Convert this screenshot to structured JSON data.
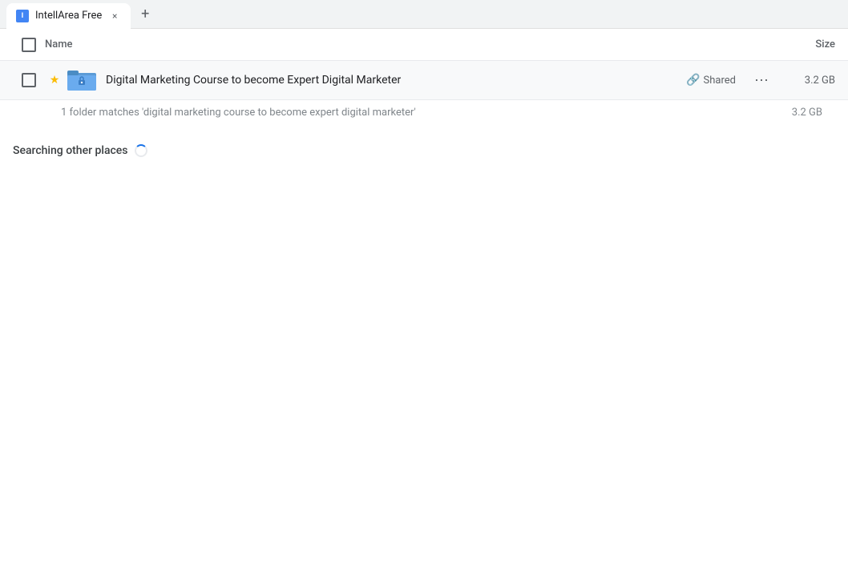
{
  "tab": {
    "favicon_label": "I",
    "title": "IntellArea Free",
    "new_tab_icon": "+"
  },
  "columns": {
    "name_label": "Name",
    "size_label": "Size"
  },
  "file_row": {
    "name": "Digital Marketing Course to become Expert Digital Marketer",
    "shared_label": "Shared",
    "size": "3.2 GB"
  },
  "summary": {
    "text": "1 folder matches 'digital marketing course to become expert digital marketer'",
    "size": "3.2 GB"
  },
  "searching_section": {
    "label": "Searching other places"
  }
}
